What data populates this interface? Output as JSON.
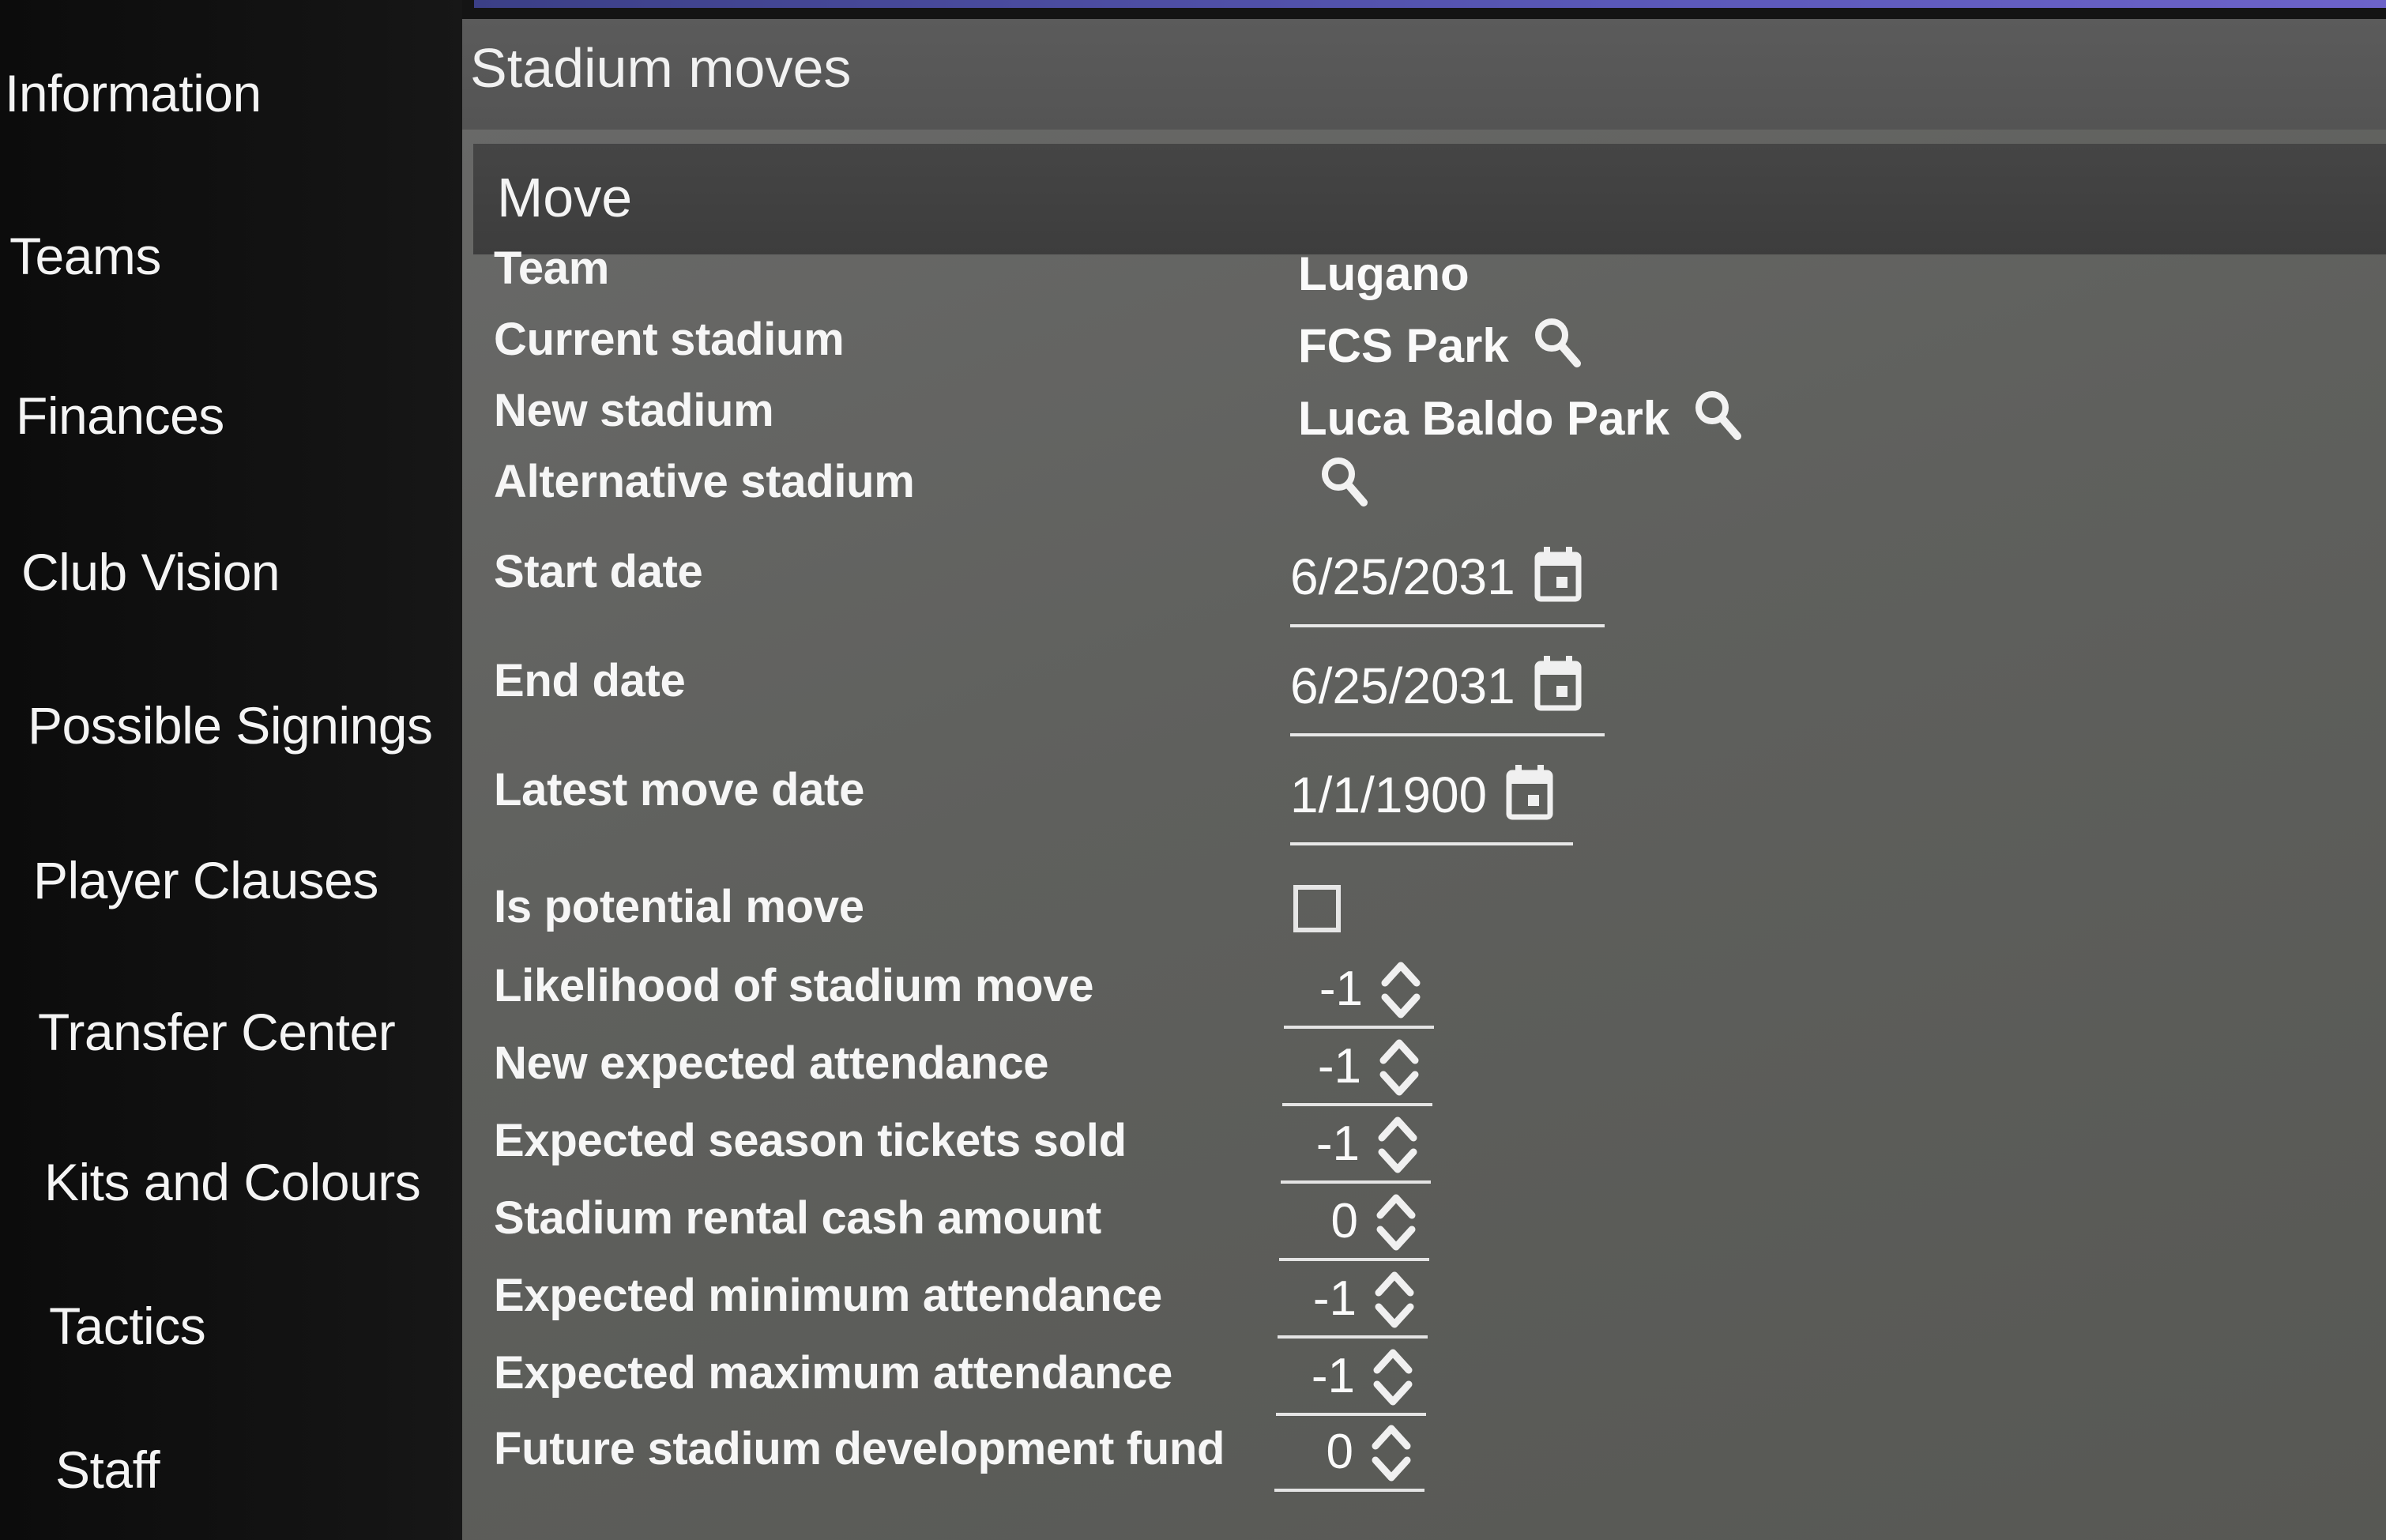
{
  "sidebar": {
    "items": [
      {
        "label": "Information"
      },
      {
        "label": "Teams"
      },
      {
        "label": "Finances"
      },
      {
        "label": "Club Vision"
      },
      {
        "label": "Possible Signings"
      },
      {
        "label": "Player Clauses"
      },
      {
        "label": "Transfer Center"
      },
      {
        "label": "Kits and Colours"
      },
      {
        "label": "Tactics"
      },
      {
        "label": "Staff"
      }
    ]
  },
  "panel": {
    "title": "Stadium moves",
    "section_title": "Move"
  },
  "fields": {
    "team": {
      "label": "Team",
      "value": "Lugano"
    },
    "current_stadium": {
      "label": "Current stadium",
      "value": "FCS Park",
      "icon": "search-icon"
    },
    "new_stadium": {
      "label": "New stadium",
      "value": "Luca Baldo Park",
      "icon": "search-icon"
    },
    "alternative_stadium": {
      "label": "Alternative stadium",
      "value": "",
      "icon": "search-icon"
    },
    "start_date": {
      "label": "Start date",
      "value": "6/25/2031",
      "icon": "calendar-icon"
    },
    "end_date": {
      "label": "End date",
      "value": "6/25/2031",
      "icon": "calendar-icon"
    },
    "latest_move_date": {
      "label": "Latest move date",
      "value": "1/1/1900",
      "icon": "calendar-icon"
    },
    "is_potential_move": {
      "label": "Is potential move",
      "checked": false
    },
    "likelihood": {
      "label": "Likelihood of stadium move",
      "value": "-1"
    },
    "new_expected_attendance": {
      "label": "New expected attendance",
      "value": "-1"
    },
    "expected_season_tickets": {
      "label": "Expected season tickets sold",
      "value": "-1"
    },
    "stadium_rental_cash": {
      "label": "Stadium rental cash amount",
      "value": "0"
    },
    "expected_min_attendance": {
      "label": "Expected minimum attendance",
      "value": "-1"
    },
    "expected_max_attendance": {
      "label": "Expected maximum attendance",
      "value": "-1"
    },
    "future_dev_fund": {
      "label": "Future stadium development fund",
      "value": "0"
    }
  },
  "colors": {
    "sidebar_bg": "#111111",
    "panel_bg": "#5f605d",
    "section_header_bg": "#3f3f3f",
    "accent_strip": "#5a58b8",
    "text": "#f4f4f4"
  }
}
